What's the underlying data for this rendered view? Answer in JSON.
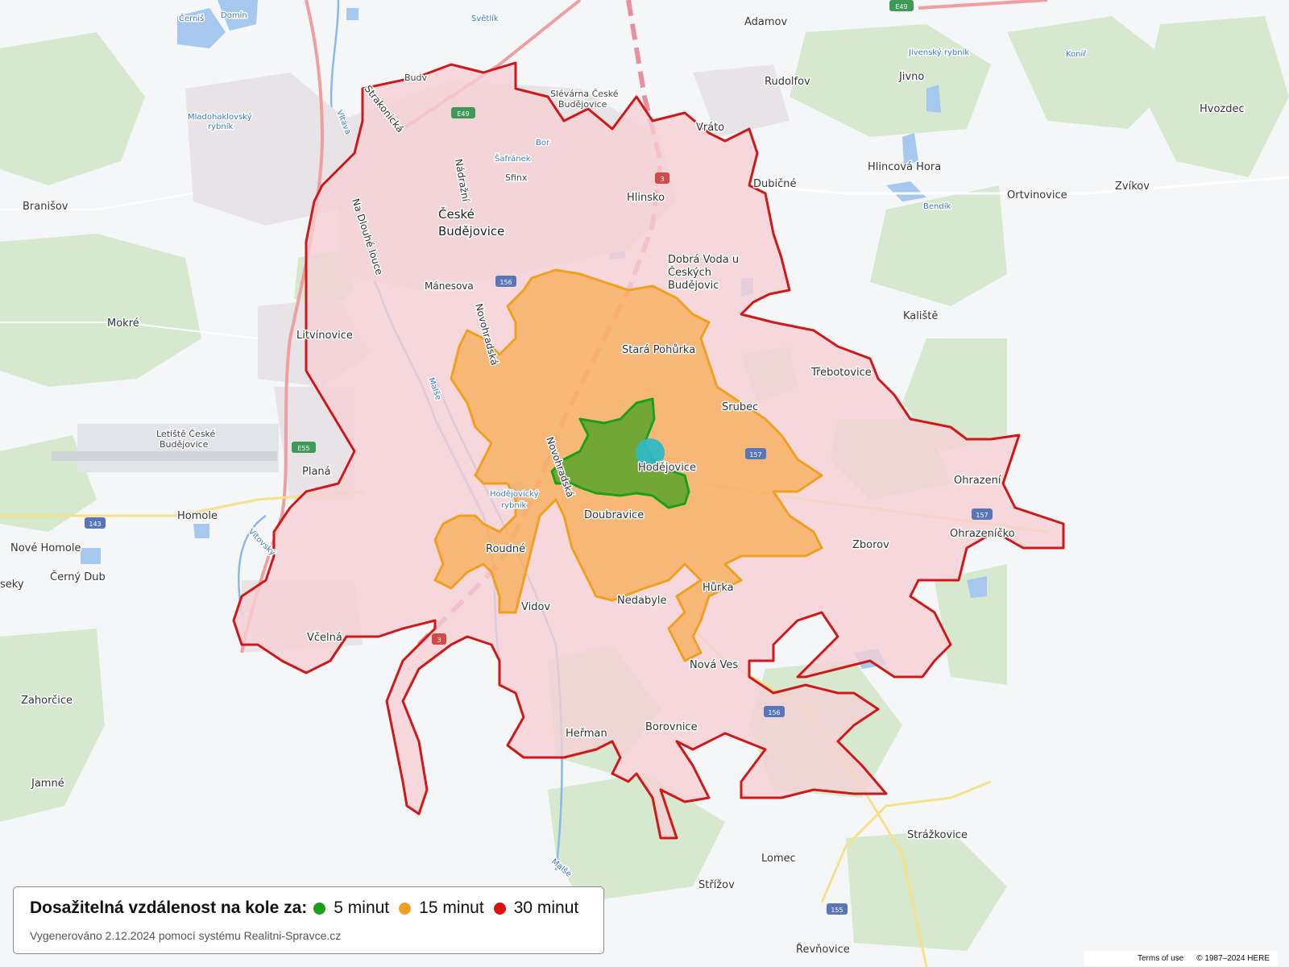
{
  "legend": {
    "title": "Dosažitelná vzdálenost na kole za:",
    "items": [
      {
        "label": "5 minut",
        "color": "#1aa01a"
      },
      {
        "label": "15 minut",
        "color": "#f0a020"
      },
      {
        "label": "30 minut",
        "color": "#e01010"
      }
    ],
    "footer": "Vygenerováno 2.12.2024 pomocí systému Realitni-Spravce.cz"
  },
  "isochrone_colors": {
    "min5_fill": "#5aa52a",
    "min5_stroke": "#1aa01a",
    "min15_fill": "#f7a640",
    "min15_stroke": "#f0a020",
    "min30_fill": "#f6cfd4",
    "min30_stroke": "#d01818",
    "marker": "#2fb8c4"
  },
  "attribution": {
    "terms": "Terms of use",
    "copyright": "© 1987–2024 HERE"
  },
  "places": {
    "ceske_budejovice": "České",
    "ceske_budejovice2": "Budějovice",
    "cerniš": "Černiš",
    "domin": "Domín",
    "svetlik": "Světlík",
    "adamov": "Adamov",
    "jivensky": "Jivenský rybník",
    "koníř": "Koníř",
    "rudolfov": "Rudolfov",
    "jivno": "Jivno",
    "hvozdec": "Hvozdec",
    "budvar": "Budv",
    "slevarna1": "Slévárna České",
    "slevarna2": "Budějovice",
    "mladohaklovsky1": "Mladohaklovský",
    "mladohaklovsky2": "rybník",
    "bor": "Bor",
    "vrato": "Vráto",
    "dubicne": "Dubičné",
    "hlincova": "Hlincová Hora",
    "ortvinovice": "Ortvinovice",
    "zvikov": "Zvíkov",
    "safranek": "Šafránek",
    "sfinx": "Sfinx",
    "bendik": "Bendík",
    "hlinsko": "Hlinsko",
    "branisov": "Branišov",
    "dobra1": "Dobrá Voda u",
    "dobra2": "Českých",
    "dobra3": "Budějovic",
    "manesova": "Mánesova",
    "kaliste": "Kaliště",
    "mokre": "Mokré",
    "litvinovice": "Litvínovice",
    "stara": "Stará Pohůrka",
    "trebotovice": "Třebotovice",
    "srubec": "Srubec",
    "letiste1": "Letiště České",
    "letiste2": "Budějovice",
    "hodejovice": "Hodějovice",
    "ohrazeni": "Ohrazení",
    "plana": "Planá",
    "hodejovicky1": "Hodějovický",
    "hodejovicky2": "rybník",
    "doubravice": "Doubravice",
    "ohrazenicko": "Ohrazeníčko",
    "homole": "Homole",
    "nove_homole": "Nové Homole",
    "roudne": "Roudné",
    "zborov": "Zborov",
    "cerny_dub": "Černý Dub",
    "seky": "seky",
    "hurka": "Hůrka",
    "vidov": "Vidov",
    "nedabyle": "Nedabyle",
    "vcelna": "Včelná",
    "nova_ves": "Nová Ves",
    "zahorcice": "Zahorčice",
    "borovnice": "Borovnice",
    "heřman": "Heřman",
    "jamne": "Jamné",
    "strazkovice": "Strážkovice",
    "lomec": "Lomec",
    "strizov": "Střížov",
    "revnovice": "Řevňovice",
    "strakonicka": "Strakonická",
    "nadrazni": "Nádražní",
    "na_dlouhe": "Na Dlouhé louce",
    "novohradska": "Novohradská",
    "novohradska2": "Novohradská",
    "vltava": "Vltava",
    "malse": "Malše",
    "vitovsky": "Vítovský",
    "malse2": "Malše"
  },
  "road_shields": {
    "e49_top": "E49",
    "e49_mid": "E49",
    "r3_top": "3",
    "r3_bot": "3",
    "r156": "156",
    "r157": "157",
    "r157b": "157",
    "e55": "E55",
    "r143": "143",
    "r156b": "156",
    "r155": "155"
  }
}
